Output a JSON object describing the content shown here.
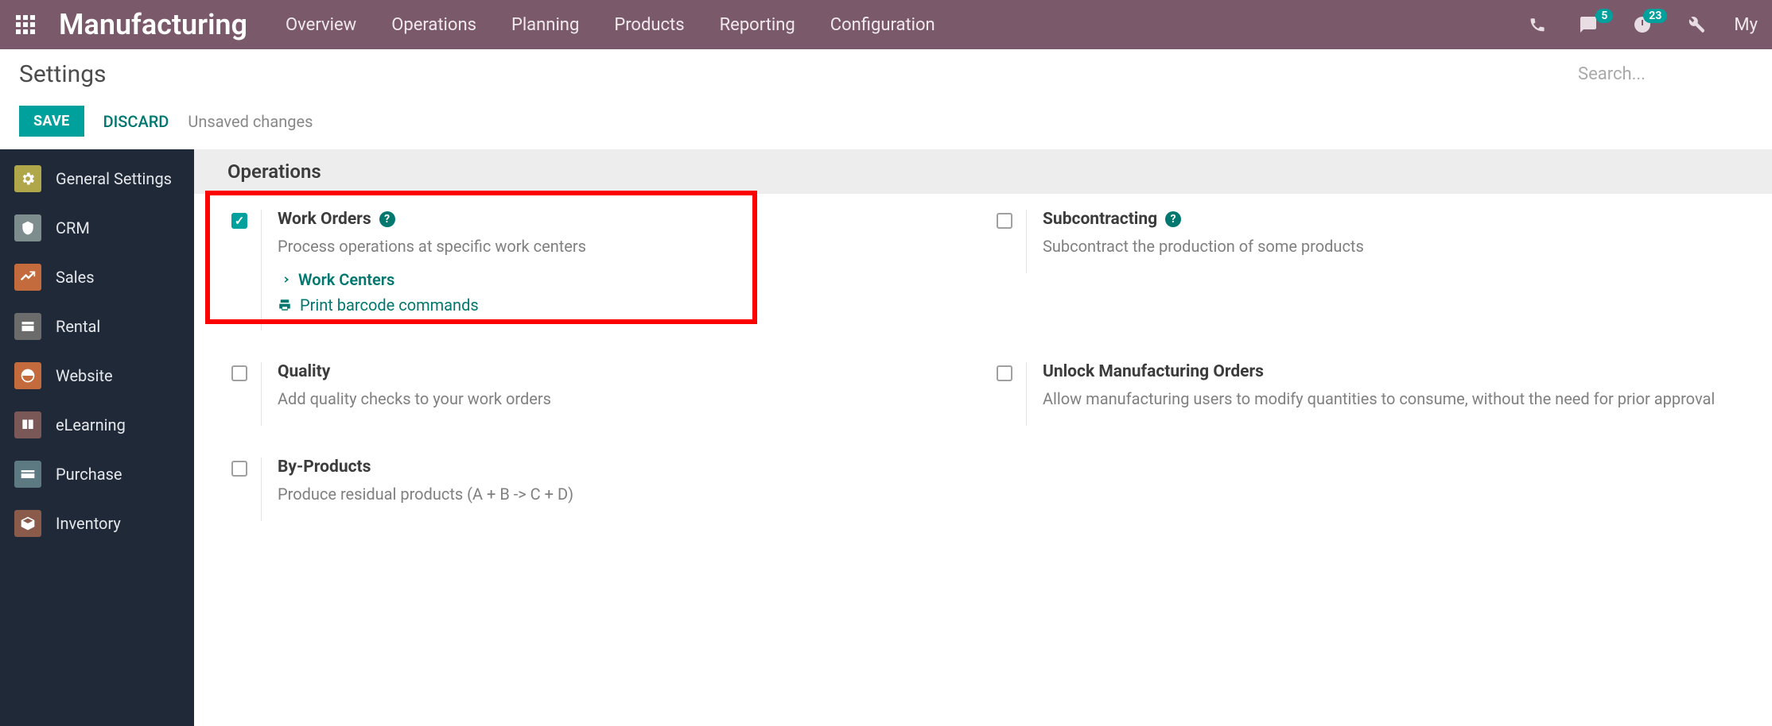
{
  "topbar": {
    "brand": "Manufacturing",
    "nav": [
      "Overview",
      "Operations",
      "Planning",
      "Products",
      "Reporting",
      "Configuration"
    ],
    "badges": {
      "chat": "5",
      "activity": "23"
    },
    "user_label": "My"
  },
  "header": {
    "title": "Settings",
    "search_placeholder": "Search..."
  },
  "actions": {
    "save": "SAVE",
    "discard": "DISCARD",
    "status": "Unsaved changes"
  },
  "sidebar": {
    "items": [
      {
        "label": "General Settings"
      },
      {
        "label": "CRM"
      },
      {
        "label": "Sales"
      },
      {
        "label": "Rental"
      },
      {
        "label": "Website"
      },
      {
        "label": "eLearning"
      },
      {
        "label": "Purchase"
      },
      {
        "label": "Inventory"
      }
    ]
  },
  "section": {
    "title": "Operations"
  },
  "settings": {
    "work_orders": {
      "title": "Work Orders",
      "desc": "Process operations at specific work centers",
      "link1": "Work Centers",
      "link2": "Print barcode commands",
      "checked": true
    },
    "subcontracting": {
      "title": "Subcontracting",
      "desc": "Subcontract the production of some products",
      "checked": false
    },
    "quality": {
      "title": "Quality",
      "desc": "Add quality checks to your work orders",
      "checked": false
    },
    "unlock_mo": {
      "title": "Unlock Manufacturing Orders",
      "desc": "Allow manufacturing users to modify quantities to consume, without the need for prior approval",
      "checked": false
    },
    "by_products": {
      "title": "By-Products",
      "desc": "Produce residual products (A + B -> C + D)",
      "checked": false
    }
  }
}
